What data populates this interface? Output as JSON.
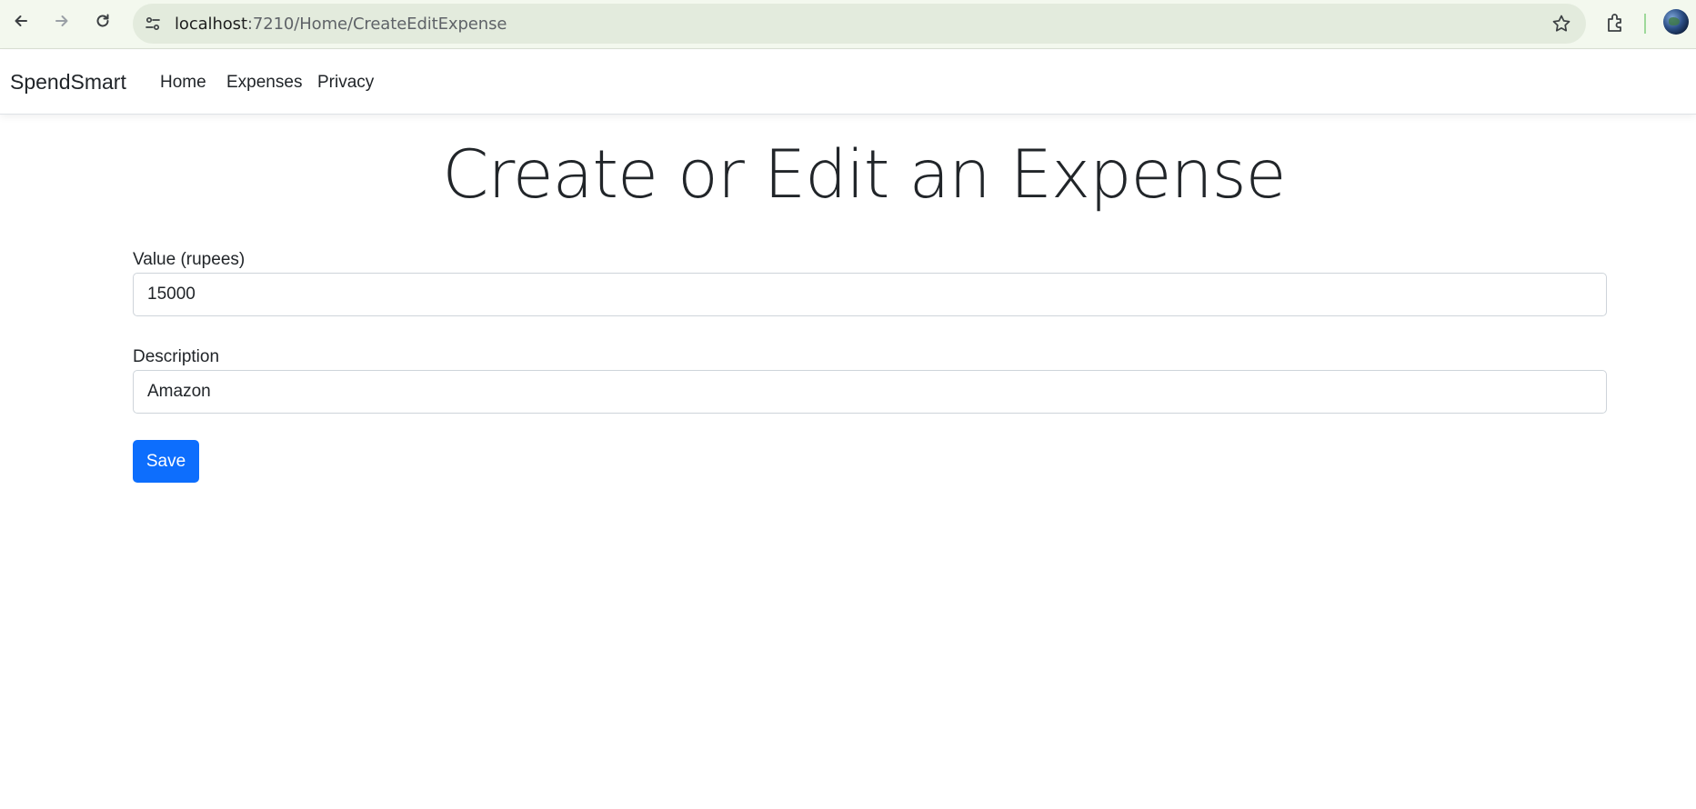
{
  "browser": {
    "url_host": "localhost",
    "url_rest": ":7210/Home/CreateEditExpense"
  },
  "navbar": {
    "brand": "SpendSmart",
    "links": [
      {
        "label": "Home"
      },
      {
        "label": "Expenses"
      },
      {
        "label": "Privacy"
      }
    ]
  },
  "main": {
    "title": "Create or Edit an Expense",
    "value_field": {
      "label": "Value (rupees)",
      "value": "15000"
    },
    "description_field": {
      "label": "Description",
      "value": "Amazon"
    },
    "save_label": "Save"
  },
  "colors": {
    "primary": "#0d6efd",
    "chrome": "#f3f8ee",
    "omnibox": "#e3ebdd"
  }
}
